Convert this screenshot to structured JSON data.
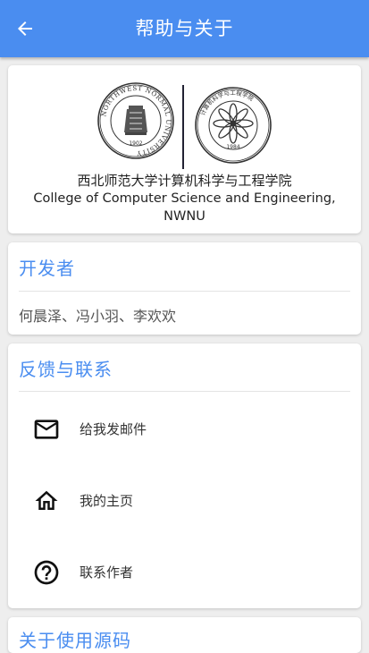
{
  "appbar": {
    "title": "帮助与关于",
    "back_icon": "arrow-left-icon",
    "color": "#4a8df0"
  },
  "school": {
    "name_cn": "西北师范大学计算机科学与工程学院",
    "name_en": "College of Computer Science and Engineering, NWNU",
    "left_logo": {
      "text": "NORTHWEST NORMAL UNIVERSITY",
      "year": "1902"
    },
    "right_logo": {
      "text_cn": "计算机科学与工程学院",
      "text_en": "College of Computer Science & Engineering",
      "year": "1984"
    }
  },
  "developers": {
    "title": "开发者",
    "names": "何晨泽、冯小羽、李欢欢"
  },
  "contact": {
    "title": "反馈与联系",
    "items": [
      {
        "label": "给我发邮件",
        "icon": "email-icon"
      },
      {
        "label": "我的主页",
        "icon": "home-icon"
      },
      {
        "label": "联系作者",
        "icon": "help-icon"
      }
    ]
  },
  "next_section": {
    "title": "关于使用源码"
  }
}
